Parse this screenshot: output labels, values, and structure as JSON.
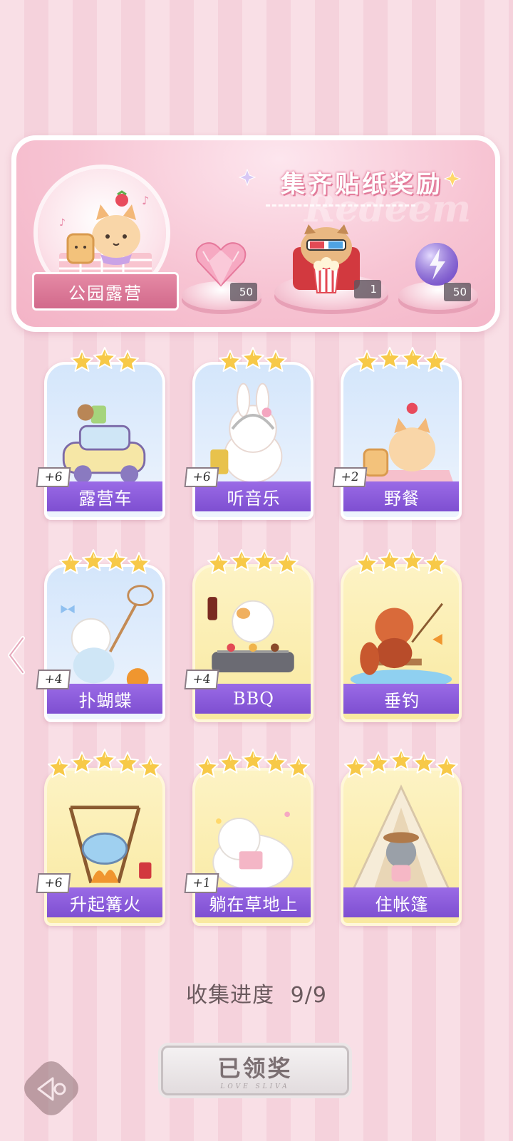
{
  "banner": {
    "title": "集齐贴纸奖励",
    "watermark": "Redeem",
    "theme_label": "公园露营",
    "rewards": [
      {
        "icon": "pink-heart-gem-icon",
        "count": "50"
      },
      {
        "icon": "popcorn-bear-icon",
        "count": "1"
      },
      {
        "icon": "purple-lightning-orb-icon",
        "count": "50"
      }
    ]
  },
  "stickers": [
    {
      "label": "露营车",
      "bonus": "+6",
      "stars": 3,
      "frame": "blue"
    },
    {
      "label": "听音乐",
      "bonus": "+6",
      "stars": 3,
      "frame": "blue"
    },
    {
      "label": "野餐",
      "bonus": "+2",
      "stars": 4,
      "frame": "blue"
    },
    {
      "label": "扑蝴蝶",
      "bonus": "+4",
      "stars": 4,
      "frame": "blue"
    },
    {
      "label": "BBQ",
      "bonus": "+4",
      "stars": 4,
      "frame": "gold"
    },
    {
      "label": "垂钓",
      "bonus": "",
      "stars": 4,
      "frame": "gold"
    },
    {
      "label": "升起篝火",
      "bonus": "+6",
      "stars": 5,
      "frame": "gold"
    },
    {
      "label": "躺在草地上",
      "bonus": "+1",
      "stars": 5,
      "frame": "gold"
    },
    {
      "label": "住帐篷",
      "bonus": "",
      "stars": 5,
      "frame": "gold"
    }
  ],
  "progress": {
    "label": "收集进度",
    "value": "9/9"
  },
  "claim_button": {
    "label": "已领奖",
    "subtitle": "LOVE SLIVA"
  },
  "colors": {
    "label_purple": "#8a5bdc",
    "banner_pink": "#f5bfd0",
    "star_gold": "#f7c948"
  }
}
